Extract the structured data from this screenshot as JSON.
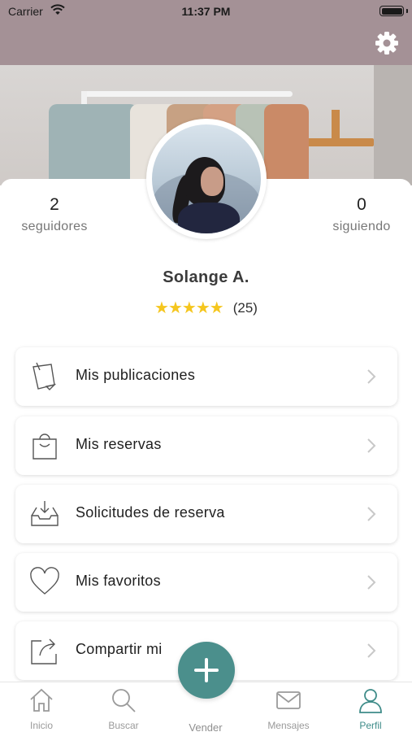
{
  "status_bar": {
    "carrier": "Carrier",
    "time": "11:37 PM"
  },
  "header": {
    "settings_icon": "gear-icon"
  },
  "profile": {
    "followers": {
      "count": "2",
      "label": "seguidores"
    },
    "following": {
      "count": "0",
      "label": "siguiendo"
    },
    "name": "Solange A.",
    "stars": "★★★★★",
    "rating_value": 5,
    "rating_count": "(25)"
  },
  "menu": [
    {
      "label": "Mis publicaciones",
      "icon": "notes-icon"
    },
    {
      "label": "Mis reservas",
      "icon": "shopping-bag-icon"
    },
    {
      "label": "Solicitudes de reserva",
      "icon": "inbox-download-icon"
    },
    {
      "label": "Mis favoritos",
      "icon": "heart-icon"
    },
    {
      "label": "Compartir mi",
      "icon": "share-icon"
    }
  ],
  "tabbar": {
    "tabs": [
      {
        "label": "Inicio",
        "icon": "home-icon"
      },
      {
        "label": "Buscar",
        "icon": "search-icon"
      },
      {
        "label": "Vender",
        "icon": "plus-icon"
      },
      {
        "label": "Mensajes",
        "icon": "mail-icon"
      },
      {
        "label": "Perfil",
        "icon": "user-icon"
      }
    ],
    "active_tab": "Perfil"
  },
  "colors": {
    "accent": "#4b8f8c",
    "header_top": "#a49196",
    "stars": "#f5c61e",
    "inactive_tab": "#9a9a9a"
  }
}
